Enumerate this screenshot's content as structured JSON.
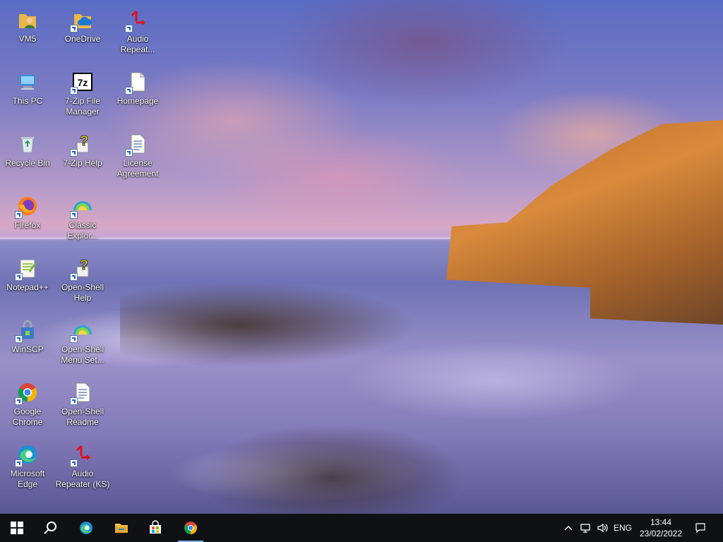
{
  "desktop": {
    "icons": [
      {
        "id": "vm5",
        "label": "VM5",
        "icon": "user-folder-icon"
      },
      {
        "id": "onedrive",
        "label": "OneDrive",
        "icon": "onedrive-folder-icon"
      },
      {
        "id": "audio-repeater-1",
        "label": "Audio\nRepeat...",
        "icon": "audio-repeater-icon"
      },
      {
        "id": "this-pc",
        "label": "This PC",
        "icon": "computer-icon"
      },
      {
        "id": "7zip-manager",
        "label": "7-Zip File\nManager",
        "icon": "7zip-icon"
      },
      {
        "id": "homepage",
        "label": "Homepage",
        "icon": "document-icon"
      },
      {
        "id": "recycle-bin",
        "label": "Recycle Bin",
        "icon": "recycle-bin-icon"
      },
      {
        "id": "7zip-help",
        "label": "7-Zip Help",
        "icon": "help-icon"
      },
      {
        "id": "license",
        "label": "License\nAgreement",
        "icon": "text-document-icon"
      },
      {
        "id": "firefox",
        "label": "Firefox",
        "icon": "firefox-icon"
      },
      {
        "id": "classic-explorer",
        "label": "Classic\nExplor...",
        "icon": "shell-icon"
      },
      {
        "id": "notepadpp",
        "label": "Notepad++",
        "icon": "notepadpp-icon"
      },
      {
        "id": "openshell-help",
        "label": "Open-Shell\nHelp",
        "icon": "help-icon"
      },
      {
        "id": "winscp",
        "label": "WinSCP",
        "icon": "winscp-icon"
      },
      {
        "id": "openshell-menu",
        "label": "Open-Shell\nMenu Set...",
        "icon": "shell-icon"
      },
      {
        "id": "chrome",
        "label": "Google\nChrome",
        "icon": "chrome-icon"
      },
      {
        "id": "openshell-readme",
        "label": "Open-Shell\nReadme",
        "icon": "text-document-icon"
      },
      {
        "id": "edge",
        "label": "Microsoft\nEdge",
        "icon": "edge-icon"
      },
      {
        "id": "audio-repeater-ks",
        "label": "Audio\nRepeater (KS)",
        "icon": "audio-repeater-icon"
      }
    ]
  },
  "taskbar": {
    "pinned": [
      "start-icon",
      "search-icon",
      "edge-icon",
      "file-explorer-icon",
      "store-icon",
      "chrome-icon"
    ],
    "active_app": "chrome-icon",
    "language": "ENG",
    "time": "13:44",
    "date": "23/02/2022"
  },
  "colors": {
    "taskbar_bg": "#101114",
    "accent": "#7fb4f0"
  }
}
